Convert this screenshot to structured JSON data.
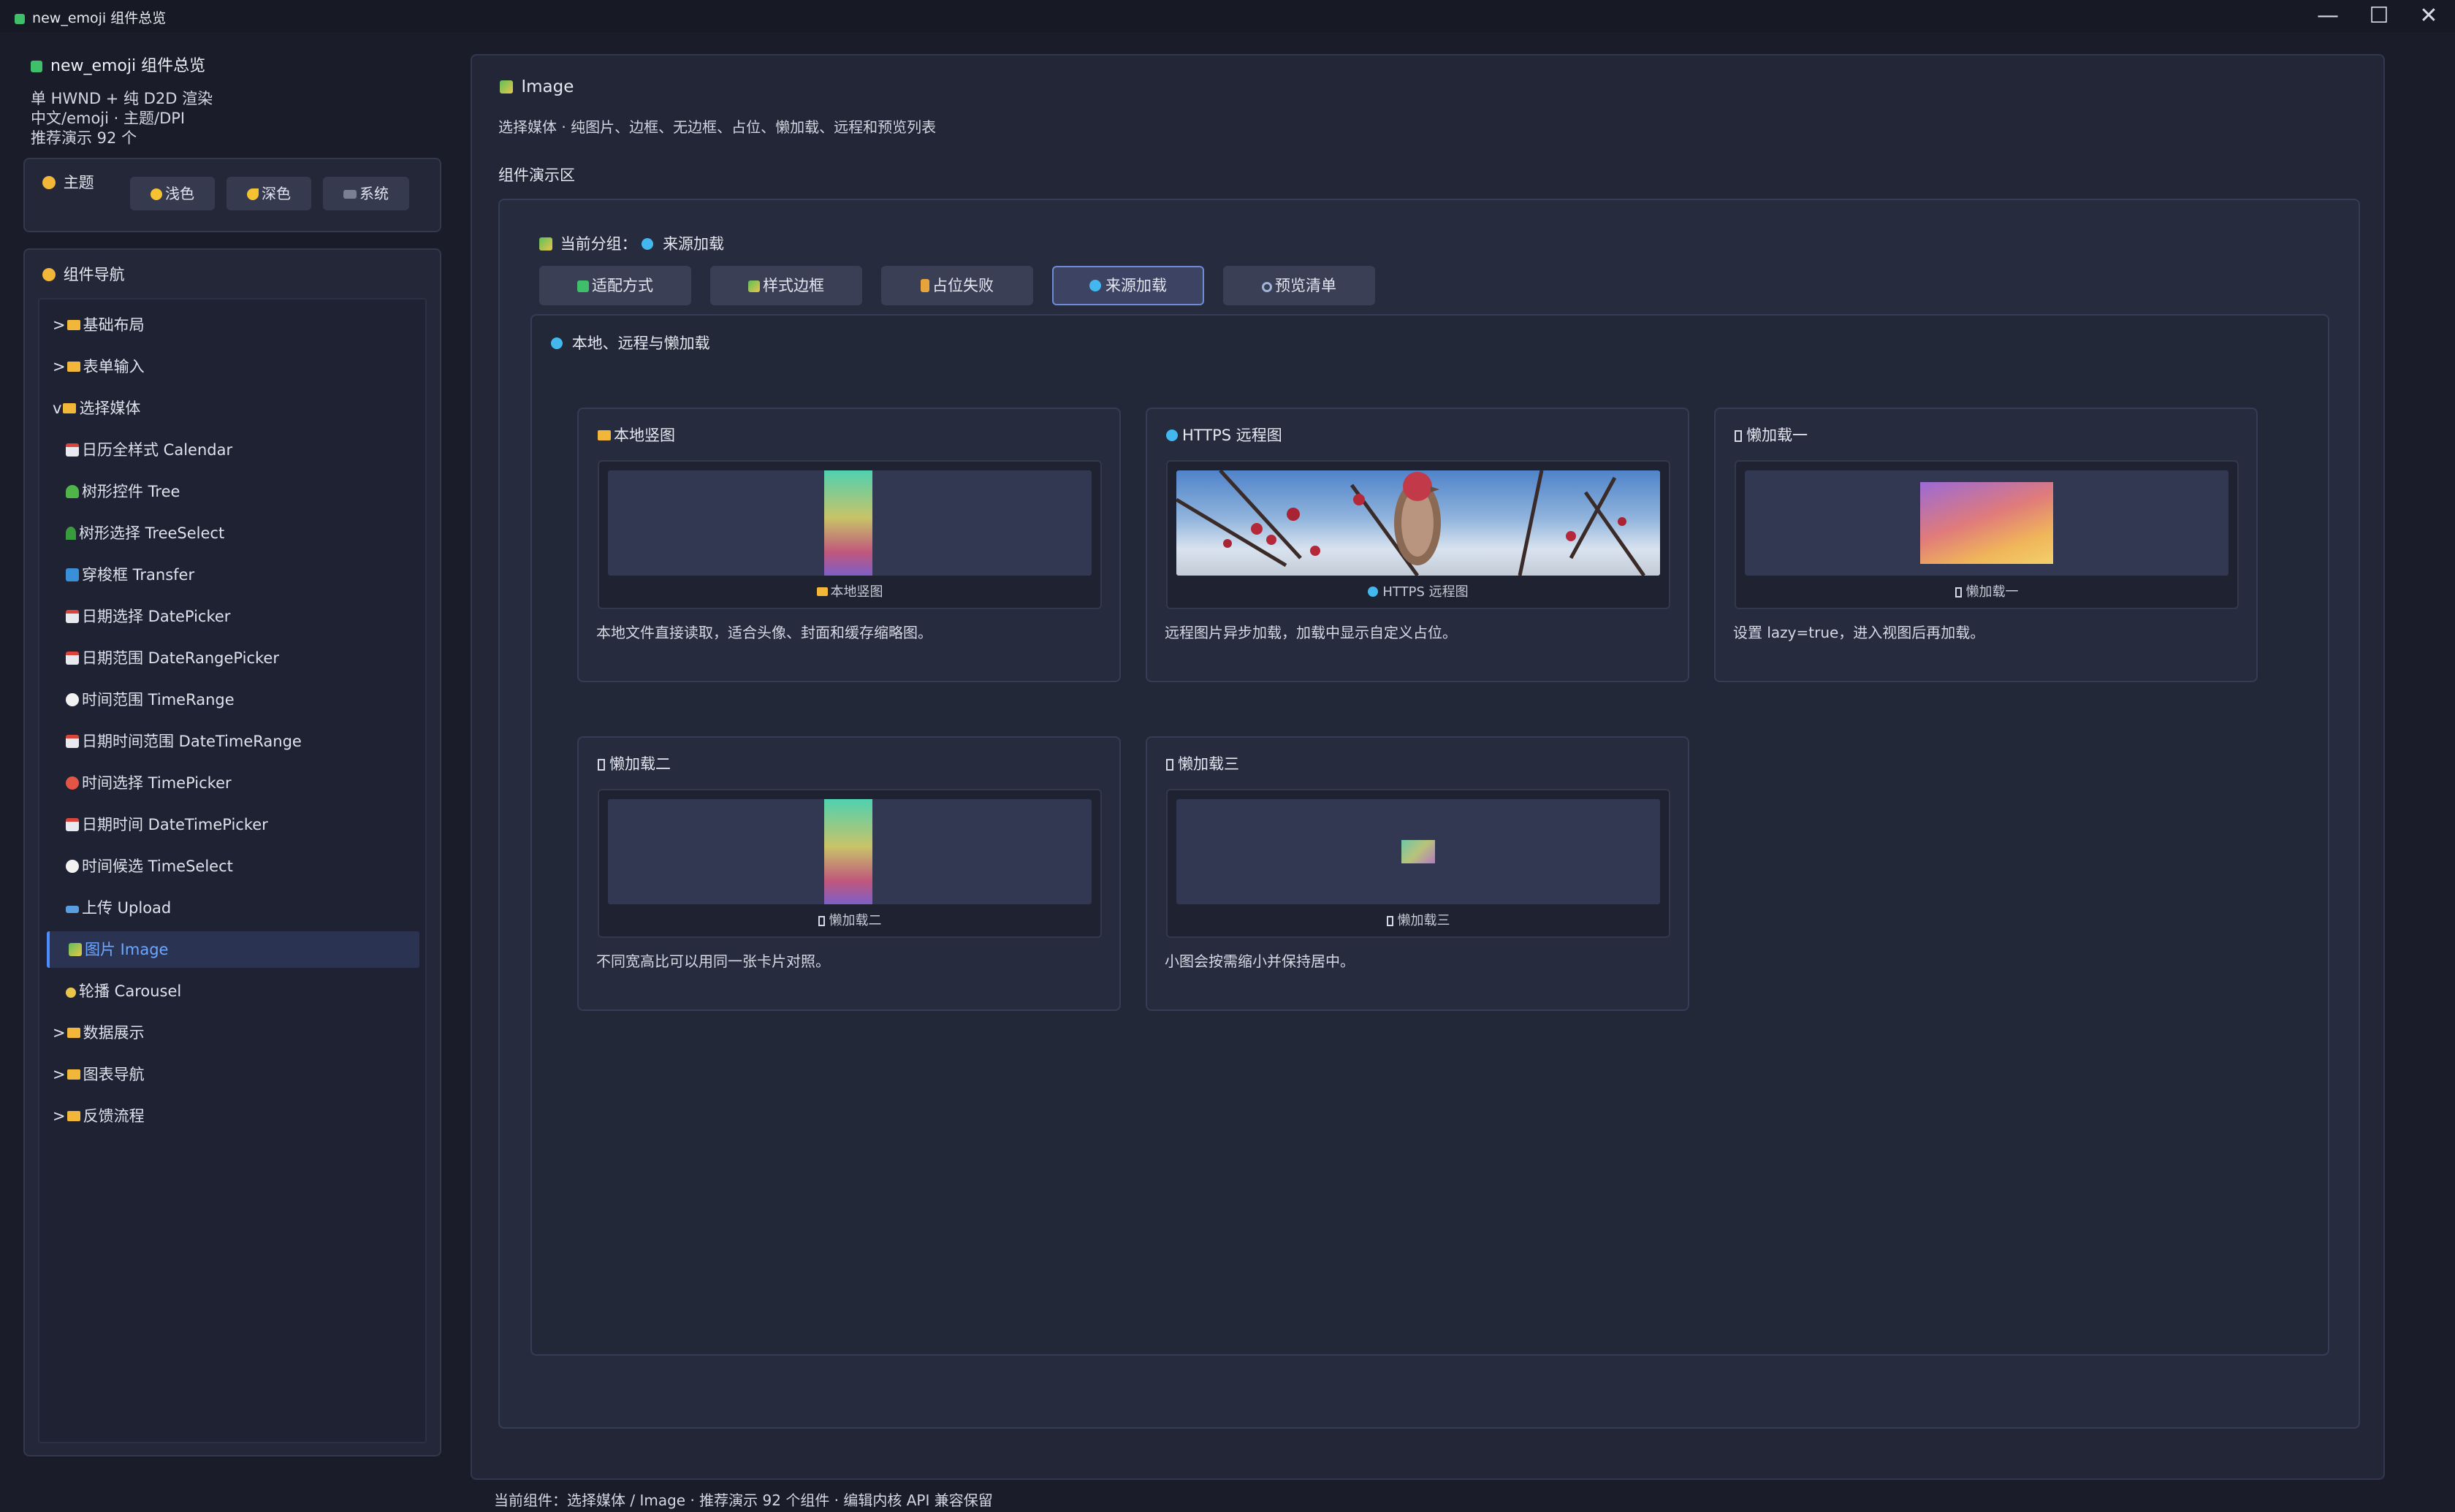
{
  "window": {
    "title": "new_emoji 组件总览",
    "controls": {
      "minimize": "—",
      "maximize": "☐",
      "close": "✕"
    }
  },
  "sidebar": {
    "app_title": "new_emoji 组件总览",
    "info_lines": [
      "单 HWND + 纯 D2D 渲染",
      "中文/emoji · 主题/DPI",
      "推荐演示 92 个"
    ],
    "theme": {
      "label": "主题",
      "buttons": [
        {
          "label": "浅色"
        },
        {
          "label": "深色"
        },
        {
          "label": "系统"
        }
      ]
    },
    "nav": {
      "label": "组件导航",
      "items": [
        {
          "prefix": ">",
          "label": "基础布局",
          "level": 0,
          "icon": "folder-icon"
        },
        {
          "prefix": ">",
          "label": "表单输入",
          "level": 0,
          "icon": "folder-icon"
        },
        {
          "prefix": "v",
          "label": "选择媒体",
          "level": 0,
          "icon": "folder-icon"
        },
        {
          "prefix": "",
          "label": "日历全样式 Calendar",
          "level": 1,
          "icon": "calendar-icon"
        },
        {
          "prefix": "",
          "label": "树形控件 Tree",
          "level": 1,
          "icon": "tree-icon"
        },
        {
          "prefix": "",
          "label": "树形选择 TreeSelect",
          "level": 1,
          "icon": "pine-icon"
        },
        {
          "prefix": "",
          "label": "穿梭框 Transfer",
          "level": 1,
          "icon": "arrows-icon"
        },
        {
          "prefix": "",
          "label": "日期选择 DatePicker",
          "level": 1,
          "icon": "calendar-icon"
        },
        {
          "prefix": "",
          "label": "日期范围 DateRangePicker",
          "level": 1,
          "icon": "calendar-icon"
        },
        {
          "prefix": "",
          "label": "时间范围 TimeRange",
          "level": 1,
          "icon": "clock-icon"
        },
        {
          "prefix": "",
          "label": "日期时间范围 DateTimeRange",
          "level": 1,
          "icon": "calendar-icon"
        },
        {
          "prefix": "",
          "label": "时间选择 TimePicker",
          "level": 1,
          "icon": "alarm-icon"
        },
        {
          "prefix": "",
          "label": "日期时间 DateTimePicker",
          "level": 1,
          "icon": "calendar-icon"
        },
        {
          "prefix": "",
          "label": "时间候选 TimeSelect",
          "level": 1,
          "icon": "clock-icon"
        },
        {
          "prefix": "",
          "label": "上传 Upload",
          "level": 1,
          "icon": "upload-icon"
        },
        {
          "prefix": "",
          "label": "图片 Image",
          "level": 1,
          "icon": "image-icon",
          "active": true
        },
        {
          "prefix": "",
          "label": "轮播 Carousel",
          "level": 1,
          "icon": "carousel-icon"
        },
        {
          "prefix": ">",
          "label": "数据展示",
          "level": 0,
          "icon": "folder-icon"
        },
        {
          "prefix": ">",
          "label": "图表导航",
          "level": 0,
          "icon": "folder-icon"
        },
        {
          "prefix": ">",
          "label": "反馈流程",
          "level": 0,
          "icon": "folder-icon"
        }
      ]
    }
  },
  "main": {
    "title": "Image",
    "description": "选择媒体 · 纯图片、边框、无边框、占位、懒加载、远程和预览列表",
    "area_label": "组件演示区",
    "group_prefix": "当前分组：",
    "group_current": "来源加载",
    "group_buttons": [
      {
        "label": "适配方式"
      },
      {
        "label": "样式边框"
      },
      {
        "label": "占位失败"
      },
      {
        "label": "来源加载",
        "active": true
      },
      {
        "label": "预览清单"
      }
    ],
    "section_title": "本地、远程与懒加载",
    "cards": [
      {
        "title": "本地竖图",
        "caption": "本地竖图",
        "description": "本地文件直接读取，适合头像、封面和缓存缩略图。"
      },
      {
        "title": "HTTPS 远程图",
        "caption": "HTTPS 远程图",
        "description": "远程图片异步加载，加载中显示自定义占位。"
      },
      {
        "title": "懒加载一",
        "caption": "懒加载一",
        "description": "设置 lazy=true，进入视图后再加载。"
      },
      {
        "title": "懒加载二",
        "caption": "懒加载二",
        "description": "不同宽高比可以用同一张卡片对照。"
      },
      {
        "title": "懒加载三",
        "caption": "懒加载三",
        "description": "小图会按需缩小并保持居中。"
      }
    ]
  },
  "statusbar": {
    "text": "当前组件：选择媒体 / Image · 推荐演示 92 个组件 · 编辑内核 API 兼容保留"
  },
  "colors": {
    "background": "#1a1c2a",
    "panel": "#232738",
    "accent": "#4c8dff",
    "active_text": "#6ea8ff",
    "dot_blue": "#43b8ee"
  }
}
